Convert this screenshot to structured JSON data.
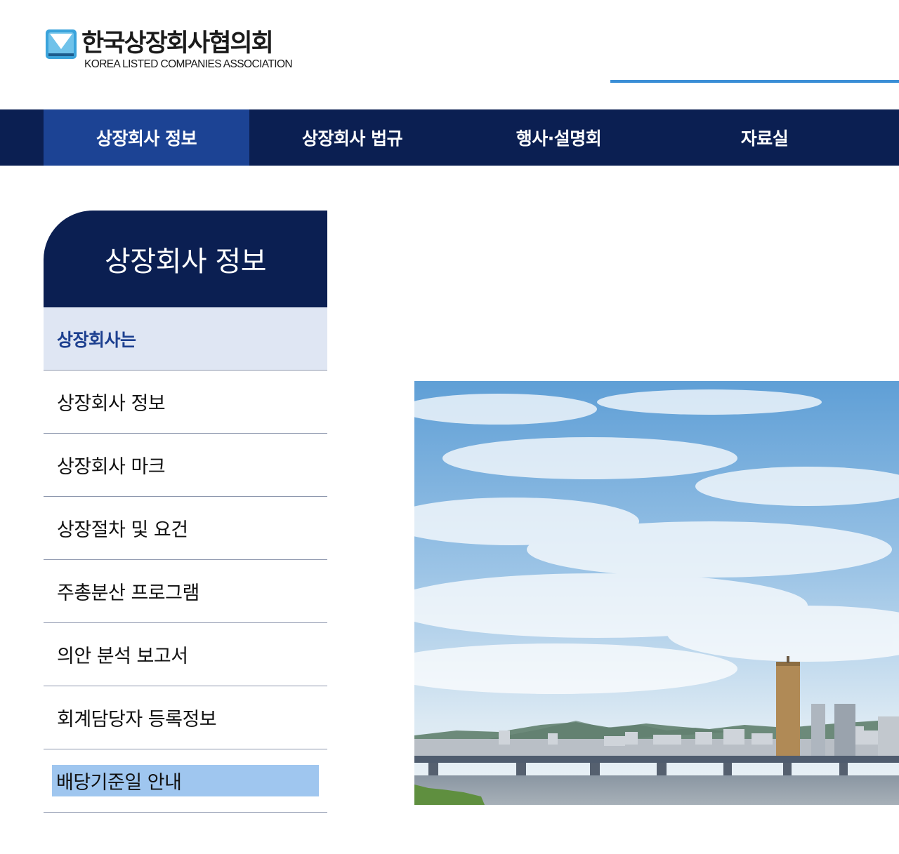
{
  "header": {
    "logo_ko": "한국상장회사협의회",
    "logo_en": "KOREA LISTED COMPANIES ASSOCIATION"
  },
  "nav": {
    "items": [
      {
        "label": "상장회사 정보",
        "active": true
      },
      {
        "label": "상장회사 법규",
        "active": false
      },
      {
        "label": "행사·설명회",
        "active": false
      },
      {
        "label": "자료실",
        "active": false
      }
    ]
  },
  "sidebar": {
    "title": "상장회사 정보",
    "subheading": "상장회사는",
    "items": [
      {
        "label": "상장회사 정보"
      },
      {
        "label": "상장회사 마크"
      },
      {
        "label": "상장절차 및 요건"
      },
      {
        "label": "주총분산 프로그램"
      },
      {
        "label": "의안 분석 보고서"
      },
      {
        "label": "회계담당자 등록정보"
      },
      {
        "label": "배당기준일 안내",
        "selected": true
      }
    ]
  },
  "hero": {
    "icon": "city-river-photo"
  },
  "colors": {
    "navy": "#0b1f52",
    "nav_active": "#1c4394",
    "header_line": "#3a8ed6",
    "sub_bg": "#dfe6f3",
    "sub_text": "#1c3f8f",
    "highlight": "#9fc6ef"
  }
}
